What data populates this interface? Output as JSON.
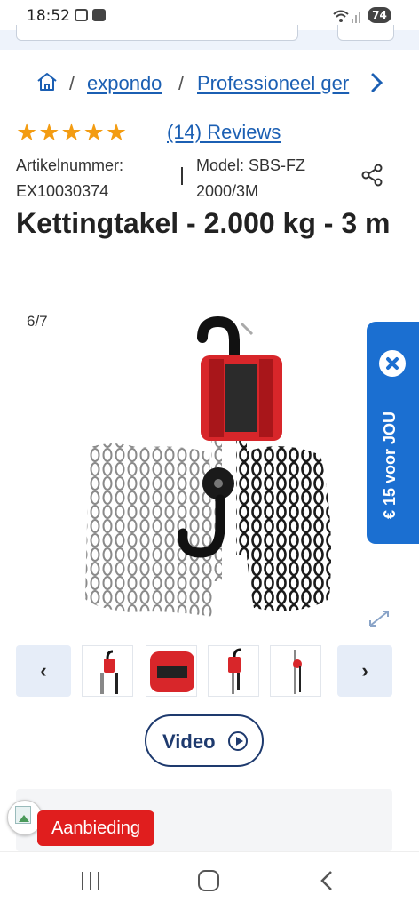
{
  "status_bar": {
    "time": "18:52",
    "battery": "74"
  },
  "breadcrumb": {
    "separator": "/",
    "crumb1": "expondo",
    "crumb2": "Professioneel ger",
    "chevron": "›"
  },
  "rating": {
    "stars": "★★★★★",
    "value": 5,
    "max": 5,
    "reviews": "(14) Reviews"
  },
  "product": {
    "article_label": "Artikelnummer:",
    "article_number": "EX10030374",
    "model_label": "Model: SBS-FZ",
    "model_value": "2000/3M",
    "title": "Kettingtakel - 2.000 kg - 3 m"
  },
  "gallery": {
    "counter": "6/7",
    "prev": "‹",
    "next": "›",
    "thumb_count": 4
  },
  "promo": {
    "text": "€ 15 voor JOU"
  },
  "video_button": {
    "label": "Video"
  },
  "offer": {
    "badge": "Aanbieding"
  },
  "colors": {
    "accent": "#1b6fd1",
    "link": "#1b5fb3",
    "star": "#f39c12",
    "badge": "#e01e1e",
    "hoist_red": "#d8262a"
  },
  "icons": [
    "home-icon",
    "share-icon",
    "close-icon",
    "expand-icon",
    "play-icon",
    "wifi-icon",
    "nav-recents-icon",
    "nav-home-icon",
    "nav-back-icon"
  ]
}
